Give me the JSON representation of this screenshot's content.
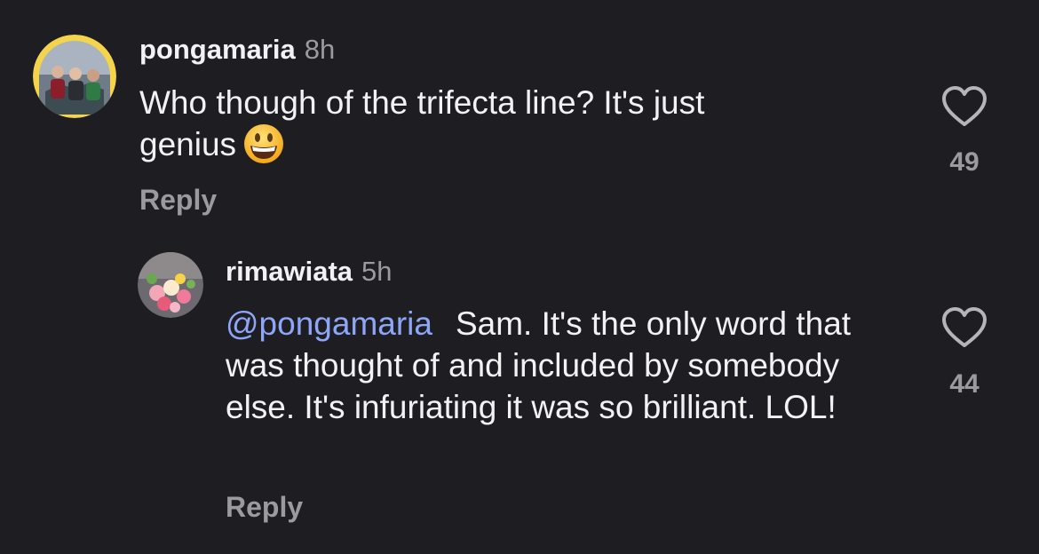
{
  "comments": [
    {
      "username": "pongamaria",
      "time": "8h",
      "text_line1": "Who though of the trifecta line? It's just",
      "text_line2": "genius",
      "emoji": "grinning-face-emoji",
      "reply_label": "Reply",
      "likes": "49"
    },
    {
      "username": "rimawiata",
      "time": "5h",
      "mention": "@pongamaria",
      "text": "Sam. It's the only word that was thought of and included by somebody else. It's infuriating it was so brilliant. LOL!",
      "reply_label": "Reply",
      "likes": "44"
    }
  ],
  "colors": {
    "background": "#1e1e22",
    "text": "#f2f2f4",
    "muted": "#9a9aa0",
    "mention": "#8ea6f7",
    "avatar_ring": "#f3d44a"
  }
}
